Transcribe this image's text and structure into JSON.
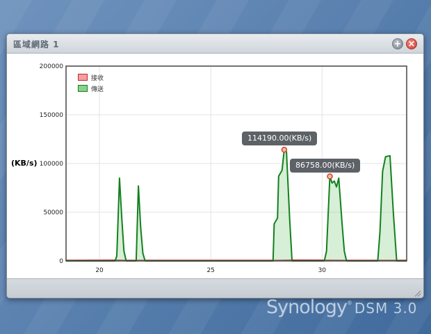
{
  "window": {
    "title": "區域網路 1",
    "add_label": "+",
    "close_label": "×"
  },
  "chart_data": {
    "type": "line",
    "ylabel": "(KB/s)",
    "ylim": [
      0,
      200000
    ],
    "xlim": [
      18.5,
      33.8
    ],
    "yticks": [
      0,
      50000,
      100000,
      150000,
      200000
    ],
    "ytick_labels": [
      "0",
      "50000",
      "100000",
      "150000",
      "200000"
    ],
    "xticks": [
      20,
      25,
      30
    ],
    "xtick_labels": [
      "20",
      "25",
      "30"
    ],
    "grid": true,
    "legend": "top-left",
    "series": [
      {
        "name": "接收",
        "color": "#c1272d",
        "fill": "#f2a0a0",
        "points": [
          [
            18.5,
            500
          ],
          [
            20.8,
            700
          ],
          [
            21.2,
            500
          ],
          [
            28.0,
            600
          ],
          [
            28.6,
            800
          ],
          [
            30.0,
            700
          ],
          [
            31.0,
            600
          ],
          [
            33.8,
            500
          ]
        ]
      },
      {
        "name": "傳送",
        "color": "#12801e",
        "fill": "#8dcf8d",
        "points": [
          [
            18.5,
            0
          ],
          [
            20.7,
            0
          ],
          [
            20.78,
            5000
          ],
          [
            20.9,
            85000
          ],
          [
            21.0,
            45000
          ],
          [
            21.1,
            10000
          ],
          [
            21.2,
            0
          ],
          [
            21.65,
            0
          ],
          [
            21.75,
            77000
          ],
          [
            21.85,
            35000
          ],
          [
            21.95,
            8000
          ],
          [
            22.05,
            0
          ],
          [
            27.8,
            0
          ],
          [
            27.85,
            38000
          ],
          [
            28.0,
            44000
          ],
          [
            28.05,
            87000
          ],
          [
            28.2,
            93000
          ],
          [
            28.3,
            114190
          ],
          [
            28.4,
            112000
          ],
          [
            28.55,
            40000
          ],
          [
            28.65,
            0
          ],
          [
            30.1,
            0
          ],
          [
            30.2,
            10000
          ],
          [
            30.35,
            86758
          ],
          [
            30.45,
            80000
          ],
          [
            30.55,
            82000
          ],
          [
            30.65,
            76000
          ],
          [
            30.75,
            85000
          ],
          [
            30.9,
            38000
          ],
          [
            31.0,
            10000
          ],
          [
            31.1,
            0
          ],
          [
            32.5,
            0
          ],
          [
            32.6,
            30000
          ],
          [
            32.72,
            92000
          ],
          [
            32.85,
            107000
          ],
          [
            33.05,
            108000
          ],
          [
            33.2,
            50000
          ],
          [
            33.35,
            0
          ],
          [
            33.8,
            0
          ]
        ]
      }
    ],
    "annotations": [
      {
        "label": "114190.00(KB/s)",
        "x": 28.3,
        "y": 114190
      },
      {
        "label": "86758.00(KB/s)",
        "x": 30.35,
        "y": 86758
      }
    ]
  },
  "brand": {
    "name": "Synology",
    "reg": "®",
    "version": "DSM 3.0"
  }
}
